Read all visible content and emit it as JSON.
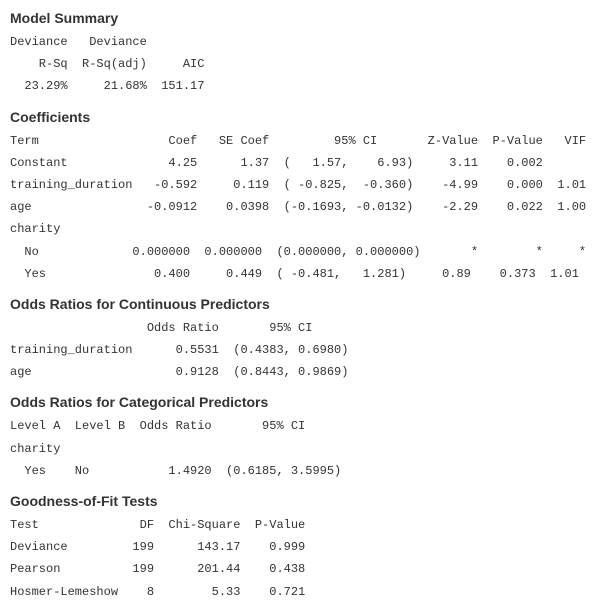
{
  "sections": {
    "model_summary": {
      "title": "Model Summary",
      "header1": "Deviance   Deviance",
      "header2": "    R-Sq  R-Sq(adj)     AIC",
      "row": "  23.29%     21.68%  151.17"
    },
    "coefficients": {
      "title": "Coefficients",
      "header": "Term                  Coef   SE Coef         95% CI       Z-Value  P-Value   VIF",
      "rows": [
        "Constant              4.25      1.37  (   1.57,    6.93)     3.11    0.002",
        "training_duration   -0.592     0.119  ( -0.825,  -0.360)    -4.99    0.000  1.01",
        "age                -0.0912    0.0398  (-0.1693, -0.0132)    -2.29    0.022  1.00",
        "charity",
        "  No             0.000000  0.000000  (0.000000, 0.000000)       *        *     *",
        "  Yes               0.400     0.449  ( -0.481,   1.281)     0.89    0.373  1.01"
      ]
    },
    "or_continuous": {
      "title": "Odds Ratios for Continuous Predictors",
      "header": "                   Odds Ratio       95% CI",
      "rows": [
        "training_duration      0.5531  (0.4383, 0.6980)",
        "age                    0.9128  (0.8443, 0.9869)"
      ]
    },
    "or_categorical": {
      "title": "Odds Ratios for Categorical Predictors",
      "header": "Level A  Level B  Odds Ratio       95% CI",
      "rows": [
        "charity",
        "  Yes    No           1.4920  (0.6185, 3.5995)"
      ]
    },
    "gof": {
      "title": "Goodness-of-Fit Tests",
      "header": "Test              DF  Chi-Square  P-Value",
      "rows": [
        "Deviance         199      143.17    0.999",
        "Pearson          199      201.44    0.438",
        "Hosmer-Lemeshow    8        5.33    0.721"
      ]
    }
  },
  "chart_data": {
    "type": "table",
    "title": "Statistical Output",
    "model_summary": {
      "deviance_rsq": "23.29%",
      "deviance_rsq_adj": "21.68%",
      "aic": 151.17
    },
    "coefficients": [
      {
        "term": "Constant",
        "coef": 4.25,
        "se_coef": 1.37,
        "ci_low": 1.57,
        "ci_high": 6.93,
        "z": 3.11,
        "p": 0.002,
        "vif": null
      },
      {
        "term": "training_duration",
        "coef": -0.592,
        "se_coef": 0.119,
        "ci_low": -0.825,
        "ci_high": -0.36,
        "z": -4.99,
        "p": 0.0,
        "vif": 1.01
      },
      {
        "term": "age",
        "coef": -0.0912,
        "se_coef": 0.0398,
        "ci_low": -0.1693,
        "ci_high": -0.0132,
        "z": -2.29,
        "p": 0.022,
        "vif": 1.0
      },
      {
        "term": "charity No",
        "coef": 0.0,
        "se_coef": 0.0,
        "ci_low": 0.0,
        "ci_high": 0.0,
        "z": "*",
        "p": "*",
        "vif": "*"
      },
      {
        "term": "charity Yes",
        "coef": 0.4,
        "se_coef": 0.449,
        "ci_low": -0.481,
        "ci_high": 1.281,
        "z": 0.89,
        "p": 0.373,
        "vif": 1.01
      }
    ],
    "odds_ratios_continuous": [
      {
        "predictor": "training_duration",
        "odds_ratio": 0.5531,
        "ci_low": 0.4383,
        "ci_high": 0.698
      },
      {
        "predictor": "age",
        "odds_ratio": 0.9128,
        "ci_low": 0.8443,
        "ci_high": 0.9869
      }
    ],
    "odds_ratios_categorical": [
      {
        "factor": "charity",
        "level_a": "Yes",
        "level_b": "No",
        "odds_ratio": 1.492,
        "ci_low": 0.6185,
        "ci_high": 3.5995
      }
    ],
    "goodness_of_fit": [
      {
        "test": "Deviance",
        "df": 199,
        "chi_square": 143.17,
        "p": 0.999
      },
      {
        "test": "Pearson",
        "df": 199,
        "chi_square": 201.44,
        "p": 0.438
      },
      {
        "test": "Hosmer-Lemeshow",
        "df": 8,
        "chi_square": 5.33,
        "p": 0.721
      }
    ]
  }
}
